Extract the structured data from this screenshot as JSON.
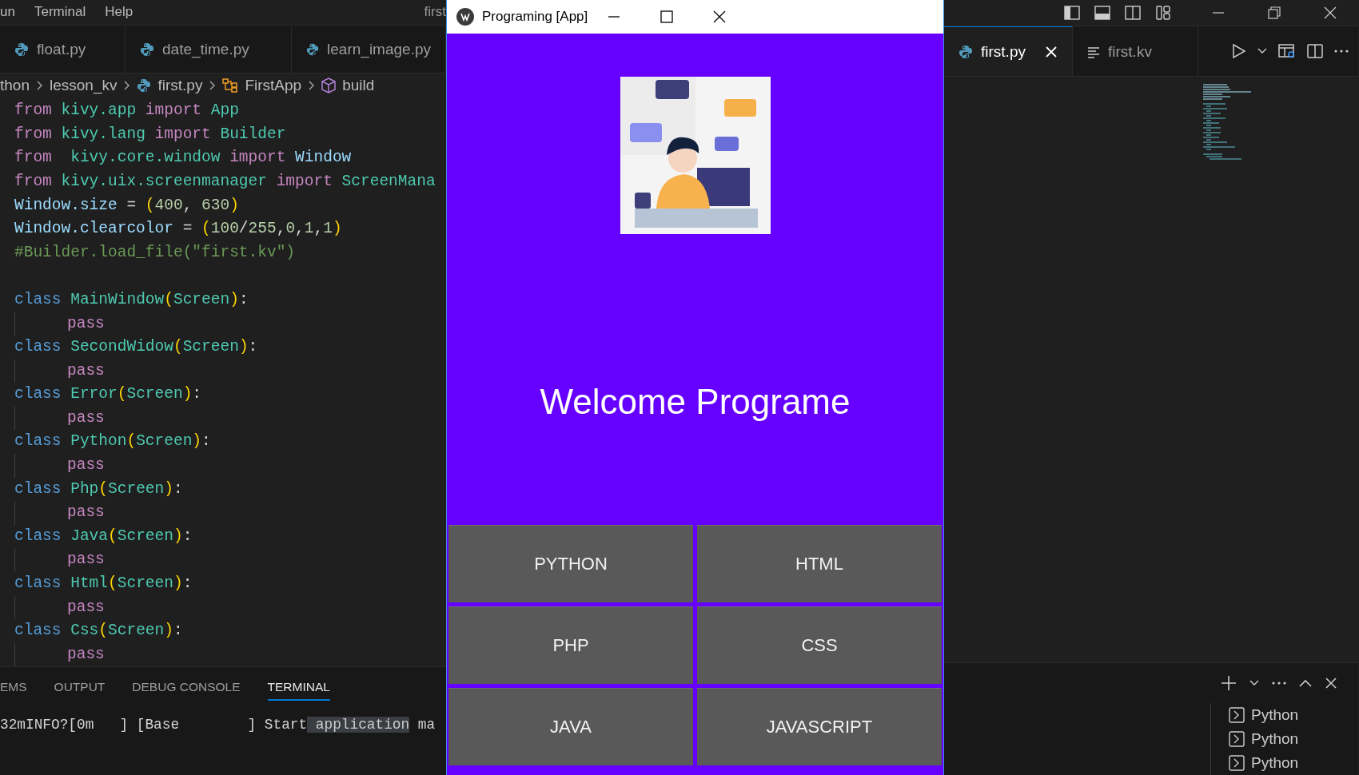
{
  "ide_left": {
    "menu": [
      "un",
      "Terminal",
      "Help"
    ],
    "title": "first",
    "tabs": [
      {
        "label": "float.py",
        "selected": false
      },
      {
        "label": "date_time.py",
        "selected": false
      },
      {
        "label": "learn_image.py",
        "selected": false
      }
    ],
    "breadcrumb": [
      {
        "kind": "folder",
        "label": "thon"
      },
      {
        "kind": "folder",
        "label": "lesson_kv"
      },
      {
        "kind": "file",
        "label": "first.py"
      },
      {
        "kind": "class",
        "label": "FirstApp"
      },
      {
        "kind": "method",
        "label": "build"
      }
    ],
    "code": [
      {
        "kind": "line",
        "tokens": [
          {
            "kind": "kw",
            "text": "from"
          },
          {
            "kind": "mod",
            "text": " kivy.app"
          },
          {
            "kind": "kw",
            "text": " import"
          },
          {
            "kind": "cls",
            "text": " App"
          }
        ]
      },
      {
        "kind": "line",
        "tokens": [
          {
            "kind": "kw",
            "text": "from"
          },
          {
            "kind": "mod",
            "text": " kivy.lang"
          },
          {
            "kind": "kw",
            "text": " import"
          },
          {
            "kind": "cls",
            "text": " Builder"
          }
        ]
      },
      {
        "kind": "line",
        "tokens": [
          {
            "kind": "kw",
            "text": "from"
          },
          {
            "kind": "mod",
            "text": "  kivy.core.window"
          },
          {
            "kind": "kw",
            "text": " import"
          },
          {
            "kind": "var",
            "text": " Window"
          }
        ]
      },
      {
        "kind": "line",
        "tokens": [
          {
            "kind": "kw",
            "text": "from"
          },
          {
            "kind": "mod",
            "text": " kivy.uix.screenmanager"
          },
          {
            "kind": "kw",
            "text": " import"
          },
          {
            "kind": "cls",
            "text": " ScreenMana"
          }
        ]
      },
      {
        "kind": "line",
        "tokens": [
          {
            "kind": "var",
            "text": "Window.size"
          },
          {
            "kind": "p",
            "text": " = "
          },
          {
            "kind": "br",
            "text": "("
          },
          {
            "kind": "num",
            "text": "400"
          },
          {
            "kind": "p",
            "text": ", "
          },
          {
            "kind": "num",
            "text": "630"
          },
          {
            "kind": "br",
            "text": ")"
          }
        ]
      },
      {
        "kind": "line",
        "tokens": [
          {
            "kind": "var",
            "text": "Window.clearcolor"
          },
          {
            "kind": "p",
            "text": " = "
          },
          {
            "kind": "br",
            "text": "("
          },
          {
            "kind": "num",
            "text": "100"
          },
          {
            "kind": "p",
            "text": "/"
          },
          {
            "kind": "num",
            "text": "255"
          },
          {
            "kind": "p",
            "text": ","
          },
          {
            "kind": "num",
            "text": "0"
          },
          {
            "kind": "p",
            "text": ","
          },
          {
            "kind": "num",
            "text": "1"
          },
          {
            "kind": "p",
            "text": ","
          },
          {
            "kind": "num",
            "text": "1"
          },
          {
            "kind": "br",
            "text": ")"
          }
        ]
      },
      {
        "kind": "line",
        "tokens": [
          {
            "kind": "com",
            "text": "#Builder.load_file(\"first.kv\")"
          }
        ]
      },
      {
        "kind": "blank"
      },
      {
        "kind": "line",
        "tokens": [
          {
            "kind": "decl",
            "text": "class"
          },
          {
            "kind": "cls",
            "text": " MainWindow"
          },
          {
            "kind": "br",
            "text": "("
          },
          {
            "kind": "cls",
            "text": "Screen"
          },
          {
            "kind": "br",
            "text": ")"
          },
          {
            "kind": "p",
            "text": ":"
          }
        ]
      },
      {
        "kind": "body",
        "tokens": [
          {
            "kind": "kw",
            "text": "pass"
          }
        ]
      },
      {
        "kind": "line",
        "tokens": [
          {
            "kind": "decl",
            "text": "class"
          },
          {
            "kind": "cls",
            "text": " SecondWidow"
          },
          {
            "kind": "br",
            "text": "("
          },
          {
            "kind": "cls",
            "text": "Screen"
          },
          {
            "kind": "br",
            "text": ")"
          },
          {
            "kind": "p",
            "text": ":"
          }
        ]
      },
      {
        "kind": "body",
        "tokens": [
          {
            "kind": "kw",
            "text": "pass"
          }
        ]
      },
      {
        "kind": "line",
        "tokens": [
          {
            "kind": "decl",
            "text": "class"
          },
          {
            "kind": "cls",
            "text": " Error"
          },
          {
            "kind": "br",
            "text": "("
          },
          {
            "kind": "cls",
            "text": "Screen"
          },
          {
            "kind": "br",
            "text": ")"
          },
          {
            "kind": "p",
            "text": ":"
          }
        ]
      },
      {
        "kind": "body",
        "tokens": [
          {
            "kind": "kw",
            "text": "pass"
          }
        ]
      },
      {
        "kind": "line",
        "tokens": [
          {
            "kind": "decl",
            "text": "class"
          },
          {
            "kind": "cls",
            "text": " Python"
          },
          {
            "kind": "br",
            "text": "("
          },
          {
            "kind": "cls",
            "text": "Screen"
          },
          {
            "kind": "br",
            "text": ")"
          },
          {
            "kind": "p",
            "text": ":"
          }
        ]
      },
      {
        "kind": "body",
        "tokens": [
          {
            "kind": "kw",
            "text": "pass"
          }
        ]
      },
      {
        "kind": "line",
        "tokens": [
          {
            "kind": "decl",
            "text": "class"
          },
          {
            "kind": "cls",
            "text": " Php"
          },
          {
            "kind": "br",
            "text": "("
          },
          {
            "kind": "cls",
            "text": "Screen"
          },
          {
            "kind": "br",
            "text": ")"
          },
          {
            "kind": "p",
            "text": ":"
          }
        ]
      },
      {
        "kind": "body",
        "tokens": [
          {
            "kind": "kw",
            "text": "pass"
          }
        ]
      },
      {
        "kind": "line",
        "tokens": [
          {
            "kind": "decl",
            "text": "class"
          },
          {
            "kind": "cls",
            "text": " Java"
          },
          {
            "kind": "br",
            "text": "("
          },
          {
            "kind": "cls",
            "text": "Screen"
          },
          {
            "kind": "br",
            "text": ")"
          },
          {
            "kind": "p",
            "text": ":"
          }
        ]
      },
      {
        "kind": "body",
        "tokens": [
          {
            "kind": "kw",
            "text": "pass"
          }
        ]
      },
      {
        "kind": "line",
        "tokens": [
          {
            "kind": "decl",
            "text": "class"
          },
          {
            "kind": "cls",
            "text": " Html"
          },
          {
            "kind": "br",
            "text": "("
          },
          {
            "kind": "cls",
            "text": "Screen"
          },
          {
            "kind": "br",
            "text": ")"
          },
          {
            "kind": "p",
            "text": ":"
          }
        ]
      },
      {
        "kind": "body",
        "tokens": [
          {
            "kind": "kw",
            "text": "pass"
          }
        ]
      },
      {
        "kind": "line",
        "tokens": [
          {
            "kind": "decl",
            "text": "class"
          },
          {
            "kind": "cls",
            "text": " Css"
          },
          {
            "kind": "br",
            "text": "("
          },
          {
            "kind": "cls",
            "text": "Screen"
          },
          {
            "kind": "br",
            "text": ")"
          },
          {
            "kind": "p",
            "text": ":"
          }
        ]
      },
      {
        "kind": "body",
        "tokens": [
          {
            "kind": "kw",
            "text": "pass"
          }
        ]
      }
    ],
    "panel_tabs": [
      {
        "label": "EMS",
        "selected": false
      },
      {
        "label": "OUTPUT",
        "selected": false
      },
      {
        "label": "DEBUG CONSOLE",
        "selected": false
      },
      {
        "label": "TERMINAL",
        "selected": true
      }
    ],
    "terminal_line": [
      {
        "kind": "p",
        "text": "32mINFO?[0m   ] [Base        ] Start"
      },
      {
        "kind": "hl",
        "text": " application"
      },
      {
        "kind": "p",
        "text": " ma"
      }
    ]
  },
  "app_window": {
    "title": "Programing [App]",
    "image": {
      "kind": "picture"
    },
    "heading": "Welcome Programe",
    "buttons": [
      "PYTHON",
      "HTML",
      "PHP",
      "CSS",
      "JAVA",
      "JAVASCRIPT"
    ]
  },
  "ide_right": {
    "tabs": [
      {
        "label": "first.py",
        "selected": true
      },
      {
        "label": "first.kv",
        "selected": false
      }
    ],
    "terminals": [
      "Python",
      "Python",
      "Python"
    ]
  }
}
